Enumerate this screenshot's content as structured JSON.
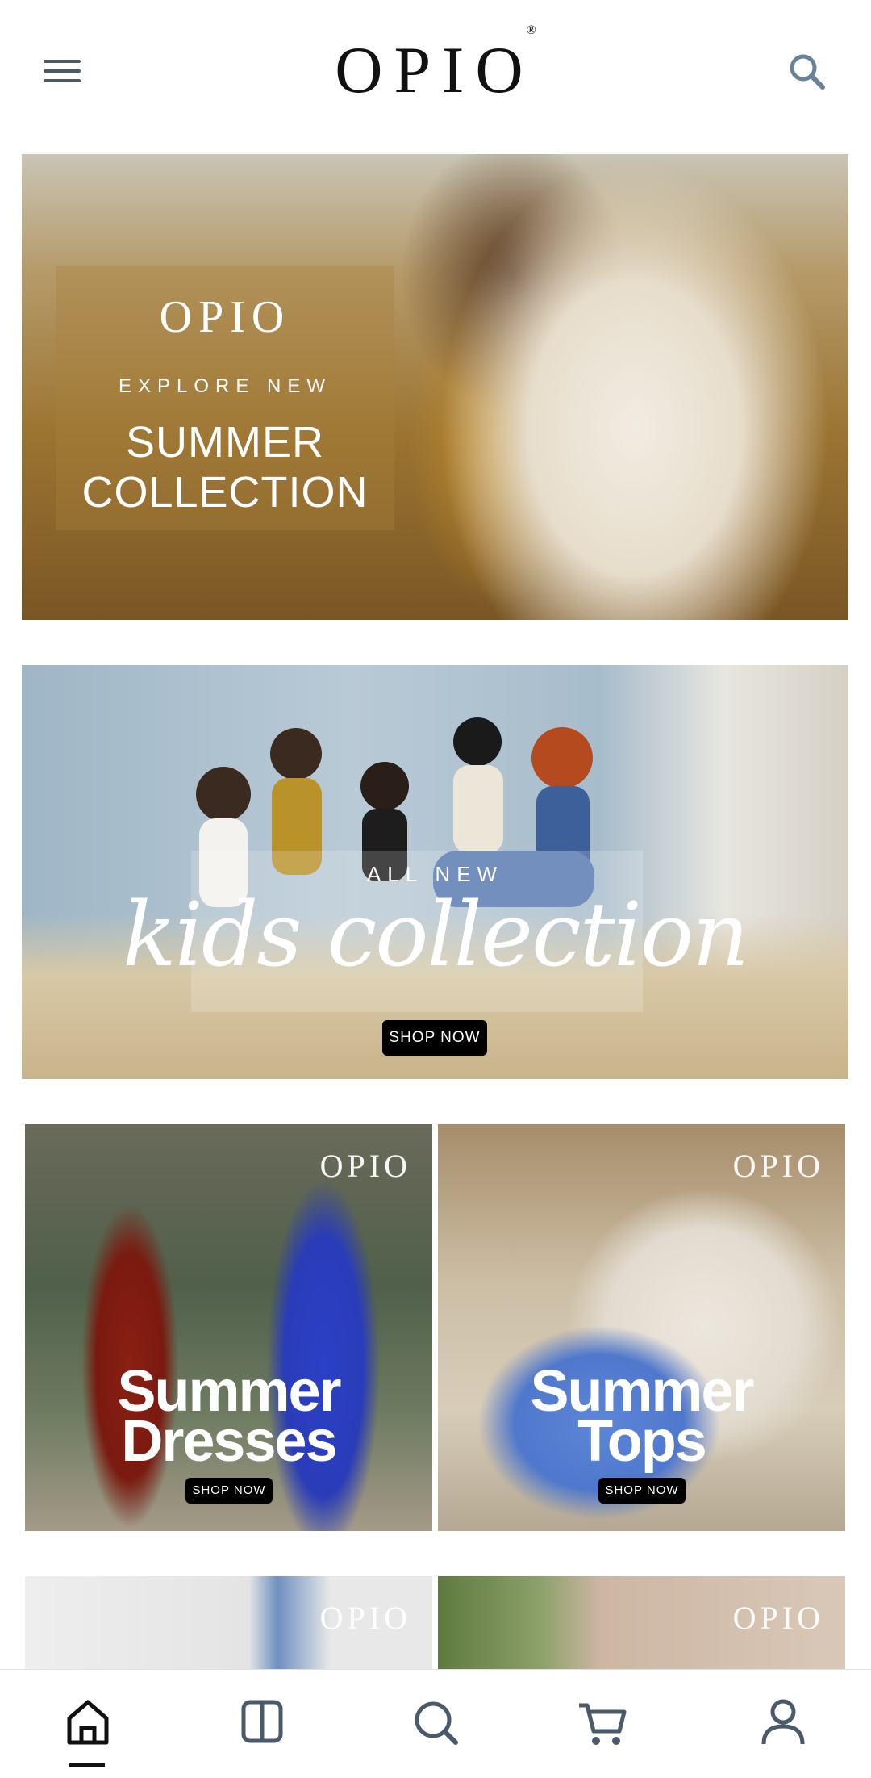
{
  "header": {
    "logo_text": "OPIO",
    "logo_mark": "®",
    "menu_icon": "hamburger-menu-icon",
    "search_icon": "search-icon"
  },
  "hero_banner": {
    "logo_text": "OPIO",
    "explore_text": "EXPLORE NEW",
    "title_line1": "SUMMER",
    "title_line2": "COLLECTION"
  },
  "kids_banner": {
    "all_new_text": "ALL NEW",
    "script_text": "kids collection",
    "shop_label": "SHOP NOW"
  },
  "tiles": [
    {
      "logo_text": "OPIO",
      "title_line1": "Summer",
      "title_line2": "Dresses",
      "shop_label": "SHOP NOW"
    },
    {
      "logo_text": "OPIO",
      "title_line1": "Summer",
      "title_line2": "Tops",
      "shop_label": "SHOP NOW"
    },
    {
      "logo_text": "OPIO"
    },
    {
      "logo_text": "OPIO"
    }
  ],
  "bottom_nav": {
    "items": [
      "home-icon",
      "categories-icon",
      "search-icon",
      "cart-icon",
      "account-icon"
    ],
    "active": "home-icon"
  },
  "colors": {
    "nav_icon": "#4a5a6a",
    "button_bg": "#000000"
  }
}
